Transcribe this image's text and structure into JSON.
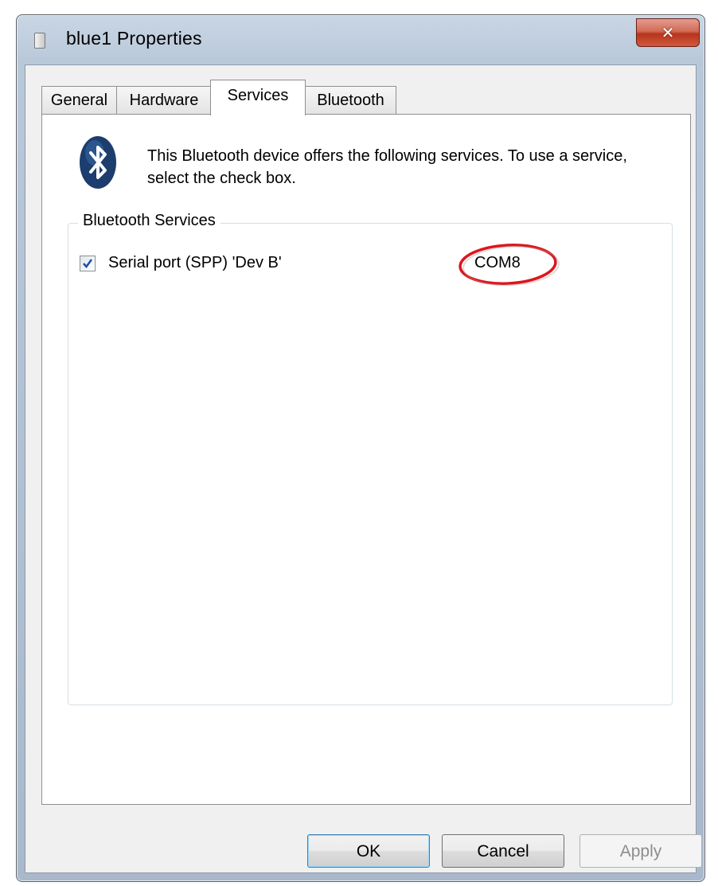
{
  "window": {
    "title": "blue1 Properties",
    "close_glyph": "✕"
  },
  "tabs": [
    {
      "label": "General"
    },
    {
      "label": "Hardware"
    },
    {
      "label": "Services",
      "active": true
    },
    {
      "label": "Bluetooth"
    }
  ],
  "services_page": {
    "icon": "bluetooth-icon",
    "intro_text": "This Bluetooth device offers the following services. To use a service, select the check box.",
    "group_title": "Bluetooth Services",
    "services": [
      {
        "label": "Serial port (SPP) 'Dev B'",
        "checked": true,
        "port": "COM8"
      }
    ],
    "highlight_color": "#e0141b"
  },
  "buttons": {
    "ok": "OK",
    "cancel": "Cancel",
    "apply": "Apply"
  },
  "colors": {
    "bluetooth_badge": "#1c3d6e",
    "close_button": "#c4452b"
  }
}
